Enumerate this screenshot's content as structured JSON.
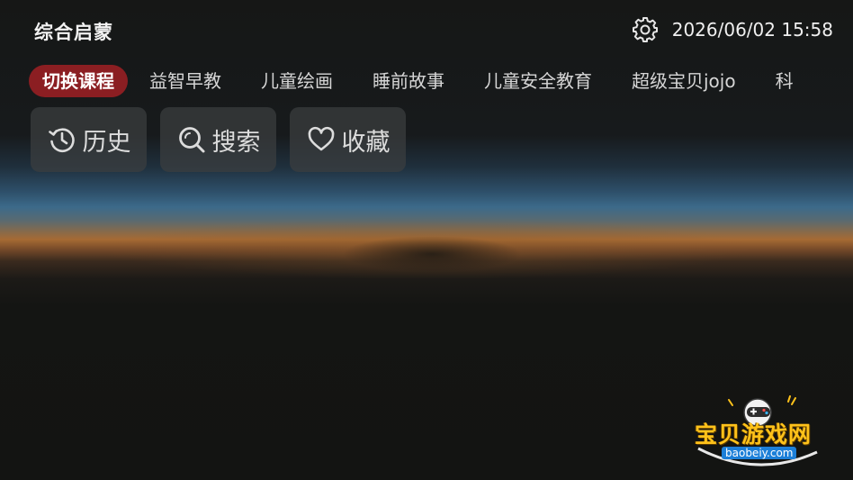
{
  "header": {
    "title": "综合启蒙",
    "datetime": "2026/06/02 15:58",
    "settings_icon": "gear-icon"
  },
  "tabs": [
    {
      "label": "切换课程",
      "active": true
    },
    {
      "label": "益智早教"
    },
    {
      "label": "儿童绘画"
    },
    {
      "label": "睡前故事"
    },
    {
      "label": "儿童安全教育"
    },
    {
      "label": "超级宝贝jojo"
    },
    {
      "label": "科"
    }
  ],
  "actions": [
    {
      "label": "历史",
      "icon": "history-icon"
    },
    {
      "label": "搜索",
      "icon": "search-icon"
    },
    {
      "label": "收藏",
      "icon": "heart-icon"
    }
  ],
  "watermark": {
    "logo_text": "宝贝游戏网",
    "url": "baobeiy.com"
  },
  "colors": {
    "active_tab_bg": "#8b1e22",
    "watermark_text": "#ffc21a",
    "watermark_url_bg": "#1c7fd8"
  }
}
